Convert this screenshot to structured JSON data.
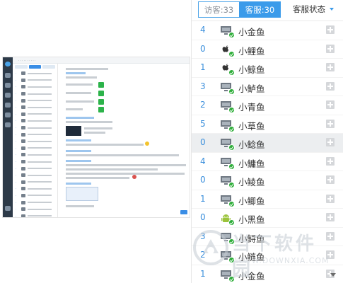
{
  "tabs": {
    "visitors_label": "访客:33",
    "service_label": "客服:30",
    "status_label": "客服状态"
  },
  "service_list": [
    {
      "count": "4",
      "name": "小金鱼",
      "avatar": "monitor-icon",
      "online": true,
      "highlighted": false
    },
    {
      "count": "0",
      "name": "小鲤鱼",
      "avatar": "apple-icon",
      "online": true,
      "highlighted": false
    },
    {
      "count": "1",
      "name": "小鲸鱼",
      "avatar": "apple-icon",
      "online": true,
      "highlighted": false
    },
    {
      "count": "3",
      "name": "小鲈鱼",
      "avatar": "monitor-icon",
      "online": true,
      "highlighted": false
    },
    {
      "count": "2",
      "name": "小青鱼",
      "avatar": "monitor-icon",
      "online": true,
      "highlighted": false
    },
    {
      "count": "5",
      "name": "小草鱼",
      "avatar": "monitor-icon",
      "online": true,
      "highlighted": false
    },
    {
      "count": "0",
      "name": "小鲶鱼",
      "avatar": "monitor-icon",
      "online": true,
      "highlighted": true
    },
    {
      "count": "4",
      "name": "小鳙鱼",
      "avatar": "monitor-icon",
      "online": true,
      "highlighted": false
    },
    {
      "count": "0",
      "name": "小鲮鱼",
      "avatar": "monitor-icon",
      "online": true,
      "highlighted": false
    },
    {
      "count": "1",
      "name": "小鲫鱼",
      "avatar": "monitor-icon",
      "online": true,
      "highlighted": false
    },
    {
      "count": "0",
      "name": "小黑鱼",
      "avatar": "android-icon",
      "online": true,
      "highlighted": false
    },
    {
      "count": "3",
      "name": "小鲟鱼",
      "avatar": "monitor-icon",
      "online": true,
      "highlighted": false
    },
    {
      "count": "2",
      "name": "小鲢鱼",
      "avatar": "monitor-icon",
      "online": true,
      "highlighted": false
    },
    {
      "count": "1",
      "name": "小金鱼",
      "avatar": "monitor-icon",
      "online": true,
      "highlighted": false
    }
  ],
  "watermark": {
    "title": "当下软件园",
    "url": "WWW.DOWNXIA.COM"
  },
  "colors": {
    "accent": "#3b9bea",
    "count_text": "#3b8fdc",
    "online": "#2fae3a",
    "highlight_row": "#eceef0"
  }
}
